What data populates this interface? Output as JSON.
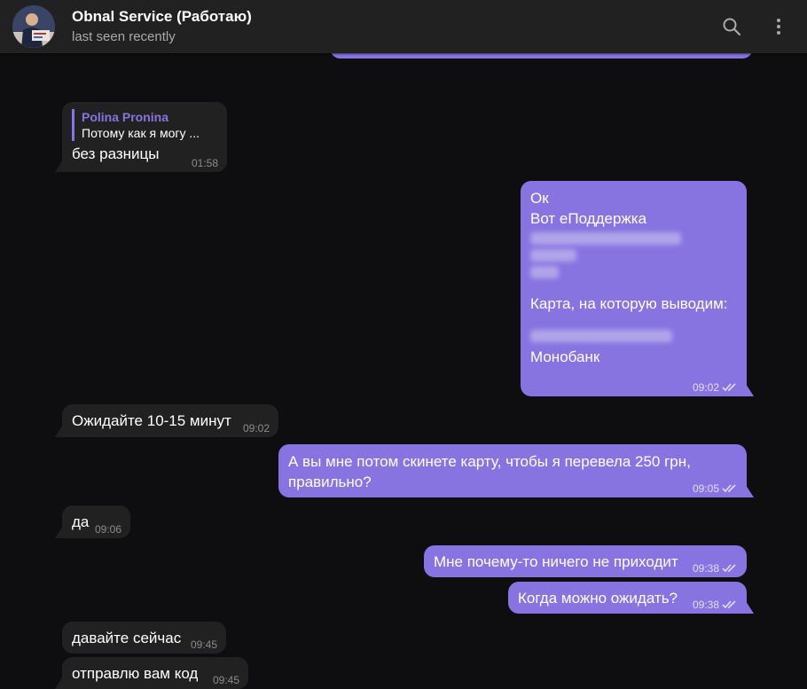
{
  "header": {
    "title": "Obnal Service (Работаю)",
    "status": "last seen recently"
  },
  "icons": {
    "search": "search-icon",
    "more": "more-vertical-icon",
    "read": "double-check-icon"
  },
  "colors": {
    "outgoing_bubble": "#8774e1",
    "incoming_bubble": "#212121",
    "background": "#0e0e10",
    "header": "#212121"
  },
  "messages": [
    {
      "direction": "in",
      "reply_to": {
        "name": "Polina Pronina",
        "text": "Потому как я могу ..."
      },
      "text": "без разницы",
      "time": "01:58"
    },
    {
      "direction": "out",
      "lines": [
        "Ок",
        "Вот еПоддержка",
        "Карта, на которую выводим:",
        "Монобанк"
      ],
      "time": "09:02",
      "read": true
    },
    {
      "direction": "in",
      "text": "Ожидайте 10-15 минут",
      "time": "09:02"
    },
    {
      "direction": "out",
      "lines": [
        "А вы мне потом скинете карту, чтобы я перевела 250 грн,",
        "правильно?"
      ],
      "time": "09:05",
      "read": true
    },
    {
      "direction": "in",
      "text": "да",
      "time": "09:06"
    },
    {
      "direction": "out",
      "text": "Мне почему-то ничего не приходит",
      "time": "09:38",
      "read": true
    },
    {
      "direction": "out",
      "text": "Когда можно ожидать?",
      "time": "09:38",
      "read": true
    },
    {
      "direction": "in",
      "text": "давайте сейчас",
      "time": "09:45"
    },
    {
      "direction": "in",
      "text": "отправлю вам код",
      "time": "09:45"
    }
  ]
}
